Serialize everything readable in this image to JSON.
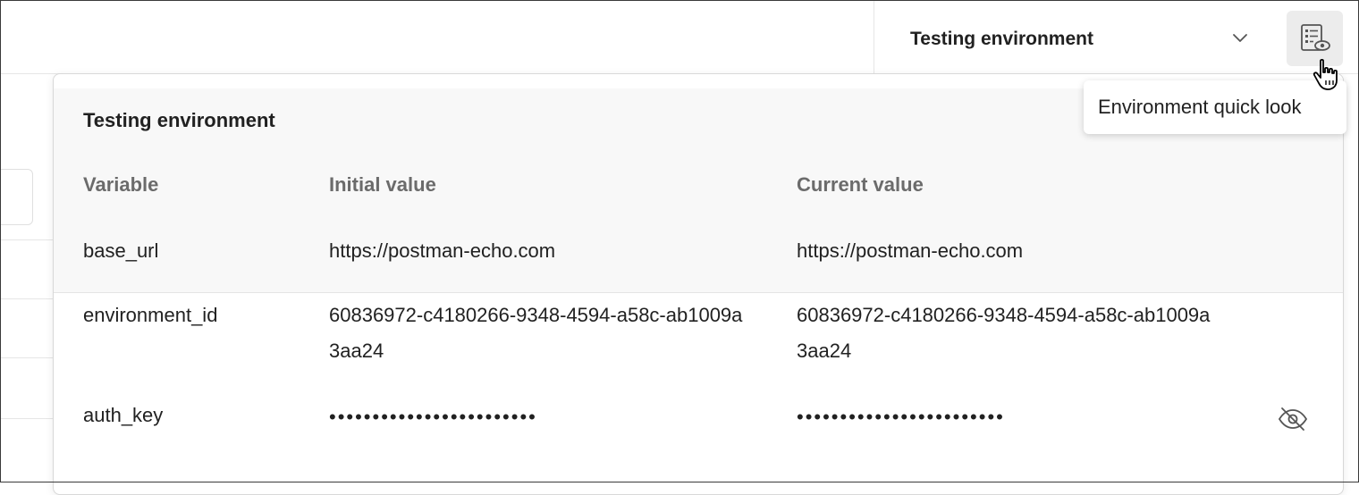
{
  "header": {
    "environment_select_label": "Testing environment",
    "quicklook_icon": "environment-quick-look-icon"
  },
  "tooltip": {
    "text": "Environment quick look"
  },
  "quicklook_panel": {
    "title": "Testing environment",
    "columns": [
      "Variable",
      "Initial value",
      "Current value"
    ],
    "rows": [
      {
        "variable": "base_url",
        "initial_value": "https://postman-echo.com",
        "current_value": "https://postman-echo.com"
      },
      {
        "variable": "environment_id",
        "initial_value": "60836972-c4180266-9348-4594-a58c-ab1009a3aa24",
        "current_value": "60836972-c4180266-9348-4594-a58c-ab1009a3aa24"
      },
      {
        "variable": "auth_key",
        "initial_value": "••••••••••••••••••••••••",
        "current_value": "••••••••••••••••••••••••",
        "masked": true,
        "action_icon": "eye-slash-icon"
      }
    ]
  },
  "colors": {
    "header_bg": "#f8f8f8",
    "muted_text": "#6b6b6b",
    "button_bg": "#ececec"
  }
}
